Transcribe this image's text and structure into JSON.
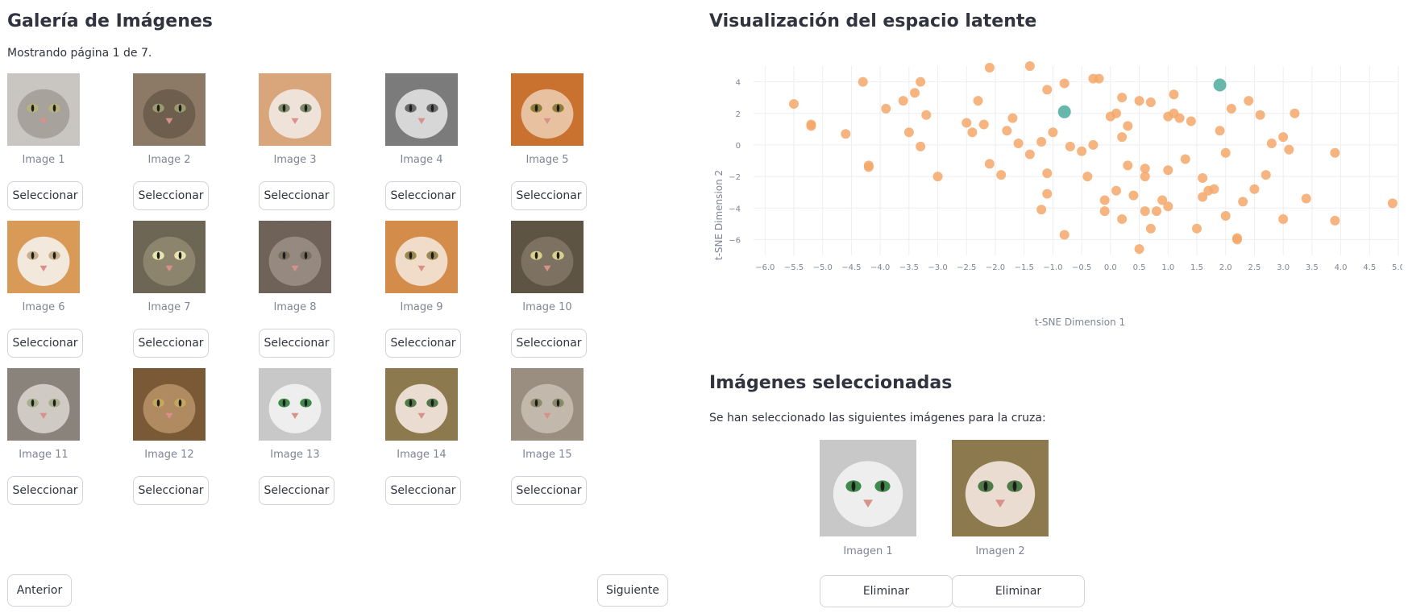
{
  "gallery": {
    "title": "Galería de Imágenes",
    "page_info": "Mostrando página 1 de 7.",
    "select_label": "Seleccionar",
    "prev_label": "Anterior",
    "next_label": "Siguiente",
    "images": [
      {
        "caption": "Image 1",
        "fur": "#c9c5c0",
        "face": "#a7a29c",
        "eyes": "#b8b37c"
      },
      {
        "caption": "Image 2",
        "fur": "#8c7a66",
        "face": "#6e5e4e",
        "eyes": "#9a9a6e"
      },
      {
        "caption": "Image 3",
        "fur": "#d9a57a",
        "face": "#efe2d8",
        "eyes": "#7f8c6c"
      },
      {
        "caption": "Image 4",
        "fur": "#7b7b7b",
        "face": "#d7d7d7",
        "eyes": "#6a6a6a"
      },
      {
        "caption": "Image 5",
        "fur": "#c9712e",
        "face": "#e8c2a0",
        "eyes": "#8f7d3a"
      },
      {
        "caption": "Image 6",
        "fur": "#d89a56",
        "face": "#f3e8dc",
        "eyes": "#c8b08c"
      },
      {
        "caption": "Image 7",
        "fur": "#6e6654",
        "face": "#8d846e",
        "eyes": "#e8e6b0"
      },
      {
        "caption": "Image 8",
        "fur": "#6f6258",
        "face": "#968a80",
        "eyes": "#7a7060"
      },
      {
        "caption": "Image 9",
        "fur": "#d48c4a",
        "face": "#f0dcc8",
        "eyes": "#9a8a50"
      },
      {
        "caption": "Image 10",
        "fur": "#5e5444",
        "face": "#7d7262",
        "eyes": "#d9d08c"
      },
      {
        "caption": "Image 11",
        "fur": "#8a837c",
        "face": "#cfcac4",
        "eyes": "#a7b08a"
      },
      {
        "caption": "Image 12",
        "fur": "#7a5a36",
        "face": "#b08a60",
        "eyes": "#c4a860"
      },
      {
        "caption": "Image 13",
        "fur": "#c8c8c8",
        "face": "#eeeeee",
        "eyes": "#3f8a4a"
      },
      {
        "caption": "Image 14",
        "fur": "#8c7a4e",
        "face": "#eadcd0",
        "eyes": "#4f7a48"
      },
      {
        "caption": "Image 15",
        "fur": "#9a8e80",
        "face": "#c2b8ac",
        "eyes": "#8a8a6a"
      }
    ]
  },
  "latent": {
    "title": "Visualización del espacio latente"
  },
  "selected": {
    "title": "Imágenes seleccionadas",
    "description": "Se han seleccionado las siguientes imágenes para la cruza:",
    "remove_label": "Eliminar",
    "items": [
      {
        "caption": "Imagen 1",
        "fur": "#c8c8c8",
        "face": "#eeeeee",
        "eyes": "#3f8a4a"
      },
      {
        "caption": "Imagen 2",
        "fur": "#8c7a4e",
        "face": "#eadcd0",
        "eyes": "#4f7a48"
      }
    ]
  },
  "chart_data": {
    "type": "scatter",
    "title": "",
    "xlabel": "t-SNE Dimension 1",
    "ylabel": "t-SNE Dimension 2",
    "xlim": [
      -6.2,
      5.0
    ],
    "ylim": [
      -7.0,
      5.0
    ],
    "x_ticks": [
      "−6.0",
      "−5.5",
      "−5.0",
      "−4.5",
      "−4.0",
      "−3.5",
      "−3.0",
      "−2.5",
      "−2.0",
      "−1.5",
      "−1.0",
      "−0.5",
      "0.0",
      "0.5",
      "1.0",
      "1.5",
      "2.0",
      "2.5",
      "3.0",
      "3.5",
      "4.0",
      "4.5",
      "5.0"
    ],
    "y_ticks": [
      "4",
      "2",
      "0",
      "−2",
      "−4",
      "−6"
    ],
    "grid": true,
    "series": [
      {
        "color": "#f4a86a",
        "points": [
          [
            -5.5,
            2.6
          ],
          [
            -5.2,
            1.3
          ],
          [
            -5.2,
            1.2
          ],
          [
            -4.6,
            0.7
          ],
          [
            -4.3,
            4.0
          ],
          [
            -4.2,
            -1.3
          ],
          [
            -4.2,
            -1.4
          ],
          [
            -3.9,
            2.3
          ],
          [
            -3.6,
            2.8
          ],
          [
            -3.5,
            0.8
          ],
          [
            -3.4,
            3.3
          ],
          [
            -3.3,
            4.0
          ],
          [
            -3.2,
            1.9
          ],
          [
            -3.3,
            -0.1
          ],
          [
            -3.0,
            -2.0
          ],
          [
            -2.5,
            1.4
          ],
          [
            -2.4,
            0.8
          ],
          [
            -2.3,
            2.8
          ],
          [
            -2.2,
            1.3
          ],
          [
            -2.1,
            4.9
          ],
          [
            -2.1,
            -1.2
          ],
          [
            -1.9,
            -1.9
          ],
          [
            -1.8,
            0.9
          ],
          [
            -1.7,
            1.7
          ],
          [
            -1.6,
            0.1
          ],
          [
            -1.4,
            5.0
          ],
          [
            -1.4,
            -0.6
          ],
          [
            -1.2,
            0.2
          ],
          [
            -1.2,
            -4.1
          ],
          [
            -1.1,
            3.5
          ],
          [
            -1.1,
            -1.8
          ],
          [
            -1.1,
            -3.1
          ],
          [
            -1.0,
            0.8
          ],
          [
            -0.8,
            3.9
          ],
          [
            -0.8,
            -5.7
          ],
          [
            -0.7,
            -0.1
          ],
          [
            -0.5,
            -0.4
          ],
          [
            -0.4,
            -2.0
          ],
          [
            -0.3,
            4.2
          ],
          [
            -0.3,
            0.0
          ],
          [
            -0.2,
            4.2
          ],
          [
            -0.1,
            -3.5
          ],
          [
            -0.1,
            -4.2
          ],
          [
            0.0,
            1.8
          ],
          [
            0.1,
            2.0
          ],
          [
            0.1,
            -2.9
          ],
          [
            0.2,
            3.0
          ],
          [
            0.2,
            0.5
          ],
          [
            0.2,
            -4.7
          ],
          [
            0.3,
            1.2
          ],
          [
            0.3,
            -1.3
          ],
          [
            0.4,
            -3.2
          ],
          [
            0.5,
            2.8
          ],
          [
            0.5,
            -6.6
          ],
          [
            0.6,
            -1.5
          ],
          [
            0.6,
            -2.0
          ],
          [
            0.6,
            -4.2
          ],
          [
            0.7,
            2.7
          ],
          [
            0.7,
            -5.3
          ],
          [
            0.8,
            -4.2
          ],
          [
            0.9,
            -3.5
          ],
          [
            1.0,
            -3.9
          ],
          [
            1.0,
            1.8
          ],
          [
            1.0,
            -1.6
          ],
          [
            1.1,
            3.2
          ],
          [
            1.1,
            2.0
          ],
          [
            1.2,
            1.7
          ],
          [
            1.3,
            -0.9
          ],
          [
            1.4,
            1.5
          ],
          [
            1.5,
            -5.3
          ],
          [
            1.6,
            -2.1
          ],
          [
            1.6,
            -3.3
          ],
          [
            1.7,
            -2.9
          ],
          [
            1.8,
            -2.8
          ],
          [
            1.9,
            0.9
          ],
          [
            2.0,
            -0.5
          ],
          [
            2.0,
            -4.5
          ],
          [
            2.1,
            2.3
          ],
          [
            2.2,
            -6.0
          ],
          [
            2.2,
            -5.9
          ],
          [
            2.3,
            -3.6
          ],
          [
            2.4,
            2.8
          ],
          [
            2.5,
            -2.8
          ],
          [
            2.6,
            1.9
          ],
          [
            2.7,
            -1.9
          ],
          [
            2.8,
            0.1
          ],
          [
            3.0,
            -4.7
          ],
          [
            3.0,
            0.5
          ],
          [
            3.1,
            -0.3
          ],
          [
            3.2,
            2.0
          ],
          [
            3.4,
            -3.4
          ],
          [
            3.9,
            -4.8
          ],
          [
            3.9,
            -0.5
          ],
          [
            4.9,
            -3.7
          ]
        ]
      },
      {
        "color": "#5fb3a8",
        "points": [
          [
            -0.8,
            2.1
          ],
          [
            1.9,
            3.8
          ]
        ]
      }
    ]
  }
}
